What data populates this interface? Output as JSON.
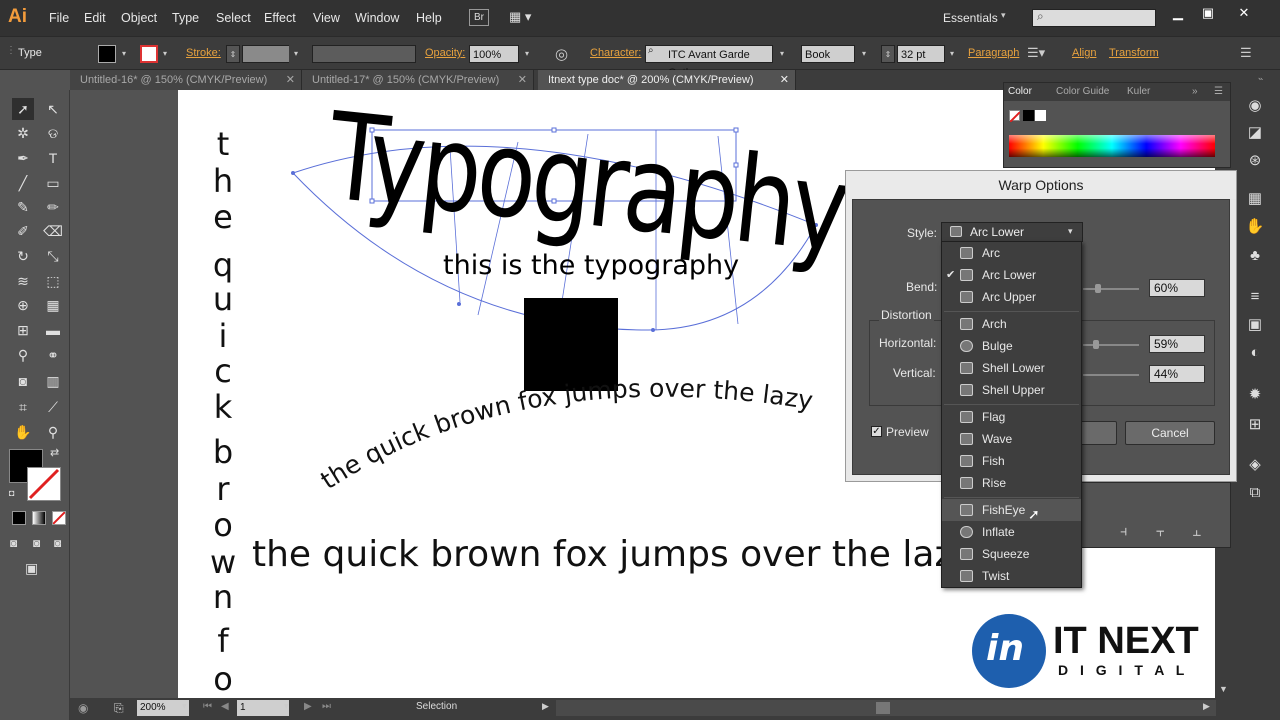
{
  "app": {
    "logo": "Ai"
  },
  "menubar": {
    "items": [
      "File",
      "Edit",
      "Object",
      "Type",
      "Select",
      "Effect",
      "View",
      "Window",
      "Help"
    ],
    "bridge": "Br",
    "workspace": "Essentials",
    "search_placeholder": ""
  },
  "controlbar": {
    "tool_label": "Type",
    "stroke_label": "Stroke:",
    "opacity_label": "Opacity:",
    "opacity_value": "100%",
    "character_label": "Character:",
    "font_value": "ITC Avant Garde Goth",
    "style_value": "Book",
    "size_value": "32 pt",
    "paragraph_label": "Paragraph",
    "align_label": "Align",
    "transform_label": "Transform"
  },
  "tabs": [
    {
      "label": "Untitled-16* @ 150% (CMYK/Preview)",
      "active": false
    },
    {
      "label": "Untitled-17* @ 150% (CMYK/Preview)",
      "active": false
    },
    {
      "label": "Itnext type doc* @ 200% (CMYK/Preview)",
      "active": true
    }
  ],
  "canvas": {
    "vertical_letters": [
      "t",
      "h",
      "e",
      "q",
      "u",
      "i",
      "c",
      "k",
      "b",
      "r",
      "o",
      "w",
      "n",
      "f",
      "o"
    ],
    "warped_word": "Typography",
    "subtitle_text": "this is the typography",
    "arc_text": "the quick brown fox jumps over the lazy",
    "line_text": "the quick brown fox jumps over the lazy",
    "logo_main": "IT NEXT",
    "logo_sub": "D I G I T A L",
    "logo_letter": "in"
  },
  "colorpanel": {
    "tabs": [
      "Color",
      "Color Guide",
      "Kuler"
    ]
  },
  "warp": {
    "title": "Warp Options",
    "style_label": "Style:",
    "style_value": "Arc Lower",
    "bend_label": "Bend:",
    "bend_value": "60%",
    "distortion_label": "Distortion",
    "horizontal_label": "Horizontal:",
    "horizontal_value": "59%",
    "vertical_label": "Vertical:",
    "vertical_value": "44%",
    "preview_label": "Preview",
    "preview_checked": true,
    "cancel_label": "Cancel"
  },
  "dropdown": {
    "items": [
      {
        "label": "Arc",
        "checked": false
      },
      {
        "label": "Arc Lower",
        "checked": true
      },
      {
        "label": "Arc Upper",
        "checked": false
      },
      {
        "label": "Arch",
        "checked": false
      },
      {
        "label": "Bulge",
        "checked": false
      },
      {
        "label": "Shell Lower",
        "checked": false
      },
      {
        "label": "Shell Upper",
        "checked": false
      },
      {
        "label": "Flag",
        "checked": false
      },
      {
        "label": "Wave",
        "checked": false
      },
      {
        "label": "Fish",
        "checked": false
      },
      {
        "label": "Rise",
        "checked": false
      },
      {
        "label": "FishEye",
        "checked": false,
        "hover": true
      },
      {
        "label": "Inflate",
        "checked": false
      },
      {
        "label": "Squeeze",
        "checked": false
      },
      {
        "label": "Twist",
        "checked": false
      }
    ]
  },
  "status": {
    "zoom": "200%",
    "page": "1",
    "tool": "Selection"
  },
  "colors": {
    "accent": "#e8a23e",
    "canvas": "#ffffff",
    "ui_dark": "#323232",
    "ui_mid": "#535353",
    "logo_blue": "#1e5fae"
  }
}
